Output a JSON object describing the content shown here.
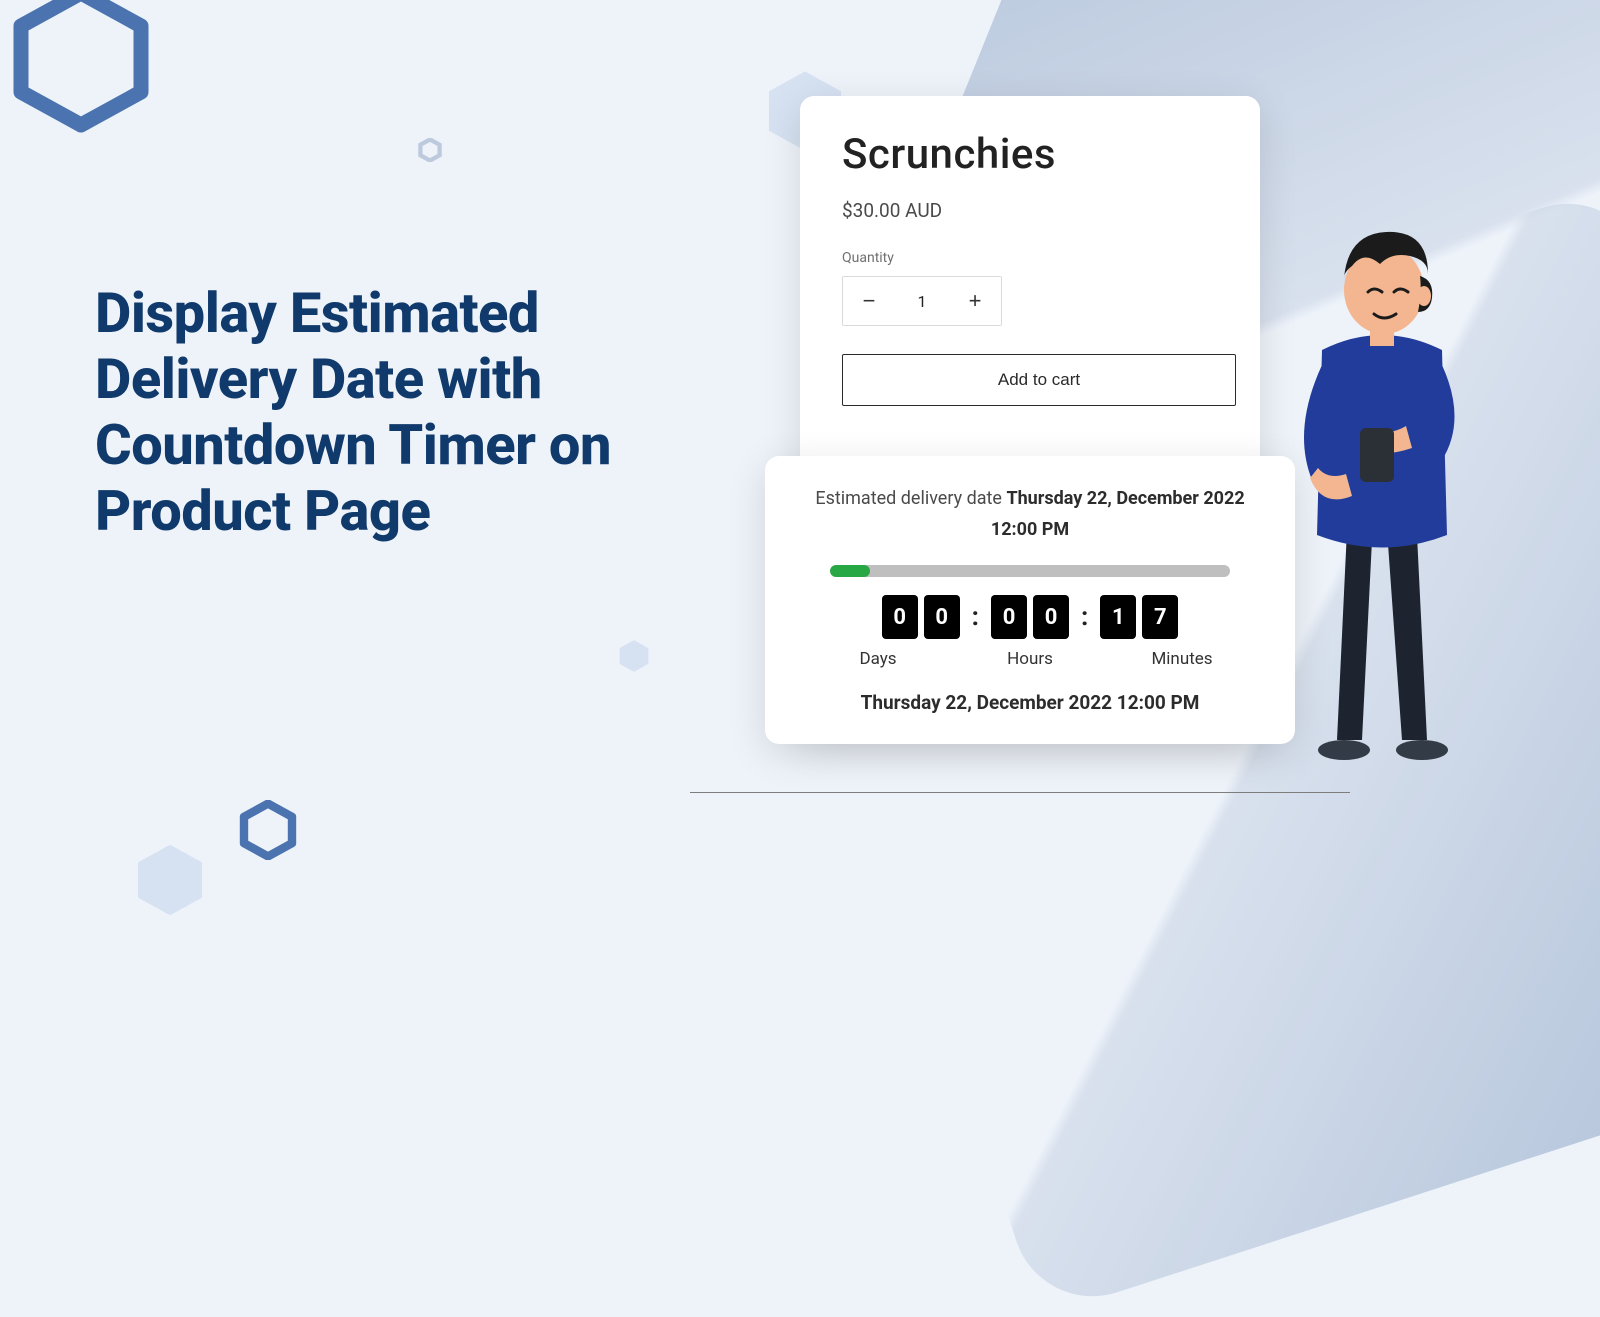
{
  "headline": "Display Estimated Delivery Date with Countdown Timer on Product Page",
  "product": {
    "title": "Scrunchies",
    "price": "$30.00 AUD",
    "quantity_label": "Quantity",
    "quantity_value": "1",
    "add_to_cart": "Add to cart"
  },
  "delivery": {
    "prefix": "Estimated delivery date ",
    "date_bold": "Thursday 22, December 2022 12:00 PM",
    "progress_percent": 10,
    "countdown": {
      "days": [
        "0",
        "0"
      ],
      "hours": [
        "0",
        "0"
      ],
      "minutes": [
        "1",
        "7"
      ]
    },
    "labels": {
      "days": "Days",
      "hours": "Hours",
      "minutes": "Minutes"
    },
    "bottom_date": "Thursday 22, December 2022 12:00 PM"
  }
}
